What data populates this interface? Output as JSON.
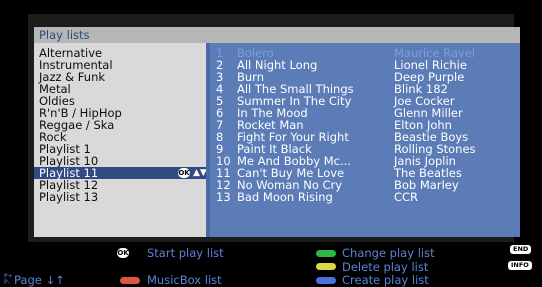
{
  "header": {
    "title": "Play lists"
  },
  "playlists": [
    "Alternative",
    "Instrumental",
    "Jazz & Funk",
    "Metal",
    "Oldies",
    "R'n'B / HipHop",
    "Reggae / Ska",
    "Rock",
    "Playlist 1",
    "Playlist 10",
    "Playlist 11",
    "Playlist 12",
    "Playlist 13"
  ],
  "selected_playlist_index": 10,
  "selected_icon": {
    "ok": "OK",
    "updown": "▲▼"
  },
  "tracks": [
    {
      "num": "1",
      "title": "Bolero",
      "artist": "Maurice Ravel"
    },
    {
      "num": "2",
      "title": "All Night Long",
      "artist": "Lionel Richie"
    },
    {
      "num": "3",
      "title": "Burn",
      "artist": "Deep Purple"
    },
    {
      "num": "4",
      "title": "All The Small Things",
      "artist": "Blink 182"
    },
    {
      "num": "5",
      "title": "Summer In The City",
      "artist": "Joe Cocker"
    },
    {
      "num": "6",
      "title": "In The Mood",
      "artist": "Glenn Miller"
    },
    {
      "num": "7",
      "title": "Rocket Man",
      "artist": "Elton John"
    },
    {
      "num": "8",
      "title": "Fight For Your Right",
      "artist": "Beastie Boys"
    },
    {
      "num": "9",
      "title": "Paint It Black",
      "artist": "Rolling Stones"
    },
    {
      "num": "10",
      "title": "Me And Bobby Mc...",
      "artist": "Janis Joplin"
    },
    {
      "num": "11",
      "title": "Can't Buy Me Love",
      "artist": "The Beatles"
    },
    {
      "num": "12",
      "title": "No Woman No Cry",
      "artist": "Bob Marley"
    },
    {
      "num": "13",
      "title": "Bad Moon Rising",
      "artist": "CCR"
    }
  ],
  "footer": {
    "ok_icon": "OK",
    "start_play_list": "Start play list",
    "change_play_list": "Change play list",
    "delete_play_list": "Delete play list",
    "create_play_list": "Create play list",
    "musicbox_list": "MusicBox list",
    "page": "Page ↓↑",
    "page_key": "P+",
    "page_key2": "P-",
    "end_tag": "END",
    "info_tag": "INFO"
  },
  "colors": {
    "green": "#2db84a",
    "yellow": "#d8d84a",
    "blue": "#4a72d8",
    "red": "#e05540",
    "selection": "#304a84",
    "list_bg": "#5b7cb6"
  }
}
